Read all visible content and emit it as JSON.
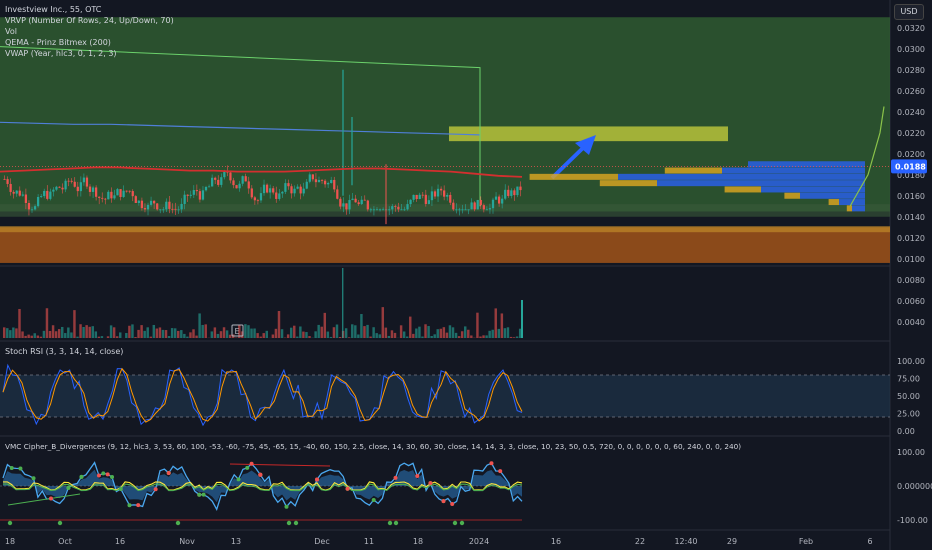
{
  "legend_main": [
    "Investview Inc., 55, OTC",
    "VRVP (Number Of Rows, 24, Up/Down, 70)",
    "Vol",
    "QEMA - Prinz Bitmex (200)",
    "VWAP (Year, hlc3, 0, 1, 2, 3)"
  ],
  "legend_stoch": "Stoch RSI (3, 3, 14, 14, close)",
  "legend_vmc": "VMC Cipher_B_Divergences (9, 12, hlc3, 3, 53, 60, 100, -53, -60, -75, 45, -65, 15, -40, 60, 150, 2.5, close, 14, 30, 60, 30, close, 14, 14, 3, 3, close, 10, 23, 50, 0.5, 720, 0, 0, 0, 0, 0, 0, 60, 240, 0, 0, 240)",
  "currency_button": "USD",
  "price_badge": "0.0188",
  "event_marker": "E",
  "colors": {
    "bg": "#131722",
    "up": "#26a69a",
    "down": "#ef5350",
    "green_zone": "#2f5a30",
    "orange_zone": "#8b4a1a",
    "accent_blue": "#2962ff",
    "yellow_box": "#b7c23a",
    "stoch_k": "#2962ff",
    "stoch_d": "#ff9800",
    "wave": "#4aa8f0"
  },
  "chart_data": [
    {
      "type": "candlestick",
      "title": "Investview Inc., 55, OTC",
      "price_axis_ticks": [
        0.032,
        0.03,
        0.028,
        0.026,
        0.024,
        0.022,
        0.02,
        0.018,
        0.016,
        0.014,
        0.012,
        0.01
      ],
      "price_axis_labels": [
        "0.0320",
        "0.0300",
        "0.0280",
        "0.0260",
        "0.0240",
        "0.0220",
        "0.0200",
        "0.0180",
        "0.0160",
        "0.0140",
        "0.0120",
        "0.0100"
      ],
      "ylim": [
        0.0095,
        0.0335
      ],
      "time_axis_labels": [
        "18",
        "Oct",
        "16",
        "Nov",
        "13",
        "Dec",
        "11",
        "18",
        "2024",
        "16",
        "22",
        "12:40",
        "29",
        "Feb",
        "6"
      ],
      "last_price": 0.0188,
      "projected_zone": [
        0.0212,
        0.0226
      ],
      "demand_zone": [
        0.0096,
        0.013
      ],
      "supply_zone_top": 0.033,
      "wide_zone": [
        0.0145,
        0.033
      ],
      "qema_200": [
        0.0183,
        0.0184,
        0.0185,
        0.0186,
        0.0187,
        0.0187,
        0.0186,
        0.0185,
        0.0184,
        0.0184,
        0.0183,
        0.0183,
        0.0183,
        0.0184,
        0.0185,
        0.0186,
        0.0186,
        0.0185,
        0.0184,
        0.0183,
        0.0181,
        0.0179,
        0.0178
      ],
      "vwap": [
        0.023,
        0.0229,
        0.0228,
        0.0228,
        0.0227,
        0.0226,
        0.0225,
        0.0224,
        0.0223,
        0.0222,
        0.0221,
        0.022,
        0.0219,
        0.0218
      ],
      "volume_profile": [
        {
          "price": 0.019,
          "up": 0.0,
          "down": 0.45
        },
        {
          "price": 0.0184,
          "up": 0.55,
          "down": 0.55
        },
        {
          "price": 0.0178,
          "up": 0.85,
          "down": 0.95
        },
        {
          "price": 0.0172,
          "up": 0.55,
          "down": 0.8
        },
        {
          "price": 0.0166,
          "up": 0.35,
          "down": 0.4
        },
        {
          "price": 0.016,
          "up": 0.15,
          "down": 0.25
        },
        {
          "price": 0.0154,
          "up": 0.1,
          "down": 0.1
        },
        {
          "price": 0.0148,
          "up": 0.05,
          "down": 0.05
        }
      ]
    },
    {
      "type": "bar",
      "title": "Vol",
      "axis_ticks": [
        0.008,
        0.006,
        0.004
      ],
      "axis_labels": [
        "0.0080",
        "0.0060",
        "0.0040"
      ]
    },
    {
      "type": "line",
      "title": "Stoch RSI (3, 3, 14, 14, close)",
      "ylim": [
        0,
        100
      ],
      "axis_labels": [
        "100.00",
        "75.00",
        "50.00",
        "25.00",
        "0.00"
      ],
      "bands": [
        80,
        20
      ]
    },
    {
      "type": "area",
      "title": "VMC Cipher_B_Divergences",
      "axis_labels": [
        "100.00",
        "0.000000",
        "-100.00"
      ]
    }
  ]
}
